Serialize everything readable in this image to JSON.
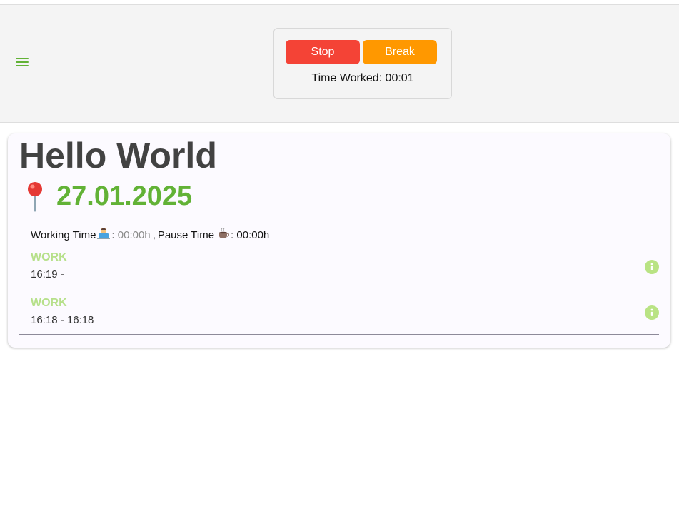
{
  "header": {
    "menu_icon": "hamburger-menu-icon",
    "accent_color": "#62b236",
    "timer": {
      "stop_label": "Stop",
      "break_label": "Break",
      "stop_color": "#f44336",
      "break_color": "#ff9800",
      "time_worked": "Time Worked: 00:01"
    }
  },
  "card": {
    "title": "Hello World",
    "date_icon": "location-pin-icon",
    "date": "27.01.2025",
    "summary": {
      "working_label": "Working Time",
      "working_icon": "technologist-emoji-icon",
      "working_value": "00:00h",
      "separator": ",",
      "pause_label": "Pause Time",
      "pause_icon": "hot-beverage-emoji-icon",
      "pause_value": "00:00h"
    },
    "entries": [
      {
        "type": "WORK",
        "time": "16:19 -",
        "icon": "info-icon"
      },
      {
        "type": "WORK",
        "time": "16:18 - 16:18",
        "icon": "info-icon"
      }
    ]
  }
}
